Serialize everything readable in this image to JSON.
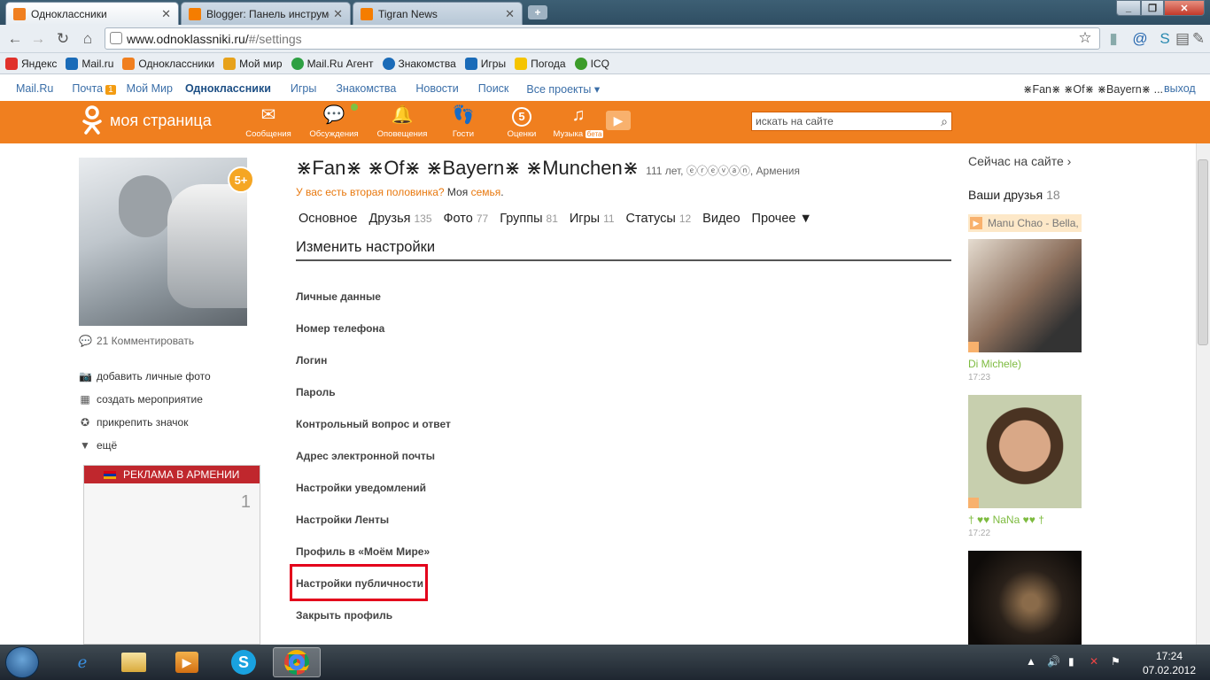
{
  "browser": {
    "tabs": [
      {
        "label": "Одноклассники",
        "favicon_color": "#f07f1f",
        "active": true
      },
      {
        "label": "Blogger: Панель инструме",
        "favicon_color": "#f57d00",
        "active": false
      },
      {
        "label": "Tigran News",
        "favicon_color": "#f57d00",
        "active": false
      }
    ],
    "new_tab_label": "+",
    "url_host": "www.odnoklassniki.ru/",
    "url_path": "#/settings",
    "bookmarks": [
      {
        "label": "Яндекс",
        "color": "#e0312b"
      },
      {
        "label": "Mail.ru",
        "color": "#1a6bb8"
      },
      {
        "label": "Одноклассники",
        "color": "#f07f1f"
      },
      {
        "label": "Мой мир",
        "color": "#e7a21b"
      },
      {
        "label": "Mail.Ru Агент",
        "color": "#2ea043"
      },
      {
        "label": "Знакомства",
        "color": "#1a6bb8"
      },
      {
        "label": "Игры",
        "color": "#1a6bb8"
      },
      {
        "label": "Погода",
        "color": "#f5c400"
      },
      {
        "label": "ICQ",
        "color": "#3c9c2a"
      }
    ]
  },
  "portal": {
    "items": [
      "Mail.Ru",
      "Почта",
      "Мой Мир",
      "Одноклассники",
      "Игры",
      "Знакомства",
      "Новости",
      "Поиск",
      "Все проекты"
    ],
    "mail_count": "1",
    "user": "⋇Fan⋇ ⋇Of⋇ ⋇Bayern⋇ ...",
    "logout": "выход"
  },
  "header": {
    "logo_label": "моя страница",
    "nav": [
      {
        "label": "Сообщения",
        "icon": "envelope-icon"
      },
      {
        "label": "Обсуждения",
        "icon": "chat-icon"
      },
      {
        "label": "Оповещения",
        "icon": "bell-icon"
      },
      {
        "label": "Гости",
        "icon": "footprints-icon"
      },
      {
        "label": "Оценки",
        "icon": "rating-icon",
        "badge": "5"
      },
      {
        "label": "Музыка",
        "icon": "music-icon",
        "badge": "бета"
      }
    ],
    "search_placeholder": "искать на сайте"
  },
  "profile": {
    "name": "⋇Fan⋇ ⋇Of⋇ ⋇Bayern⋇ ⋇Munchen⋇",
    "meta": "111 лет, ⓔⓡⓔⓥⓐⓝ, Армения",
    "age_badge": "5+",
    "partner_q": "У вас есть вторая половинка?",
    "partner_b": "Моя",
    "partner_link": "семья",
    "partner_end": ".",
    "comments": "21 Комментировать",
    "actions": [
      "добавить личные фото",
      "создать мероприятие",
      "прикрепить значок",
      "ещё"
    ]
  },
  "tabs": [
    {
      "label": "Основное",
      "count": ""
    },
    {
      "label": "Друзья",
      "count": "135"
    },
    {
      "label": "Фото",
      "count": "77"
    },
    {
      "label": "Группы",
      "count": "81"
    },
    {
      "label": "Игры",
      "count": "11"
    },
    {
      "label": "Статусы",
      "count": "12"
    },
    {
      "label": "Видео",
      "count": ""
    },
    {
      "label": "Прочее ▼",
      "count": ""
    }
  ],
  "settings": {
    "title": "Изменить настройки",
    "links": [
      "Личные данные",
      "Номер телефона",
      "Логин",
      "Пароль",
      "Контрольный вопрос и ответ",
      "Адрес электронной почты",
      "Настройки уведомлений",
      "Настройки Ленты",
      "Профиль в «Моём Мире»",
      "Настройки публичности",
      "Закрыть профиль"
    ],
    "highlighted": "Настройки публичности"
  },
  "ad": {
    "title": "РЕКЛАМА В АРМЕНИИ",
    "page": "1"
  },
  "sidebar": {
    "now_on_site": "Сейчас на сайте ›",
    "friends_label": "Ваши друзья",
    "friends_count": "18",
    "music": "Manu Chao - Bella,",
    "friends": [
      {
        "name": "Di Michele)",
        "time": "17:23"
      },
      {
        "name": "† ♥♥ NaNa ♥♥ †",
        "time": "17:22"
      },
      {
        "name": "",
        "time": ""
      }
    ]
  },
  "taskbar": {
    "time": "17:24",
    "date": "07.02.2012"
  }
}
